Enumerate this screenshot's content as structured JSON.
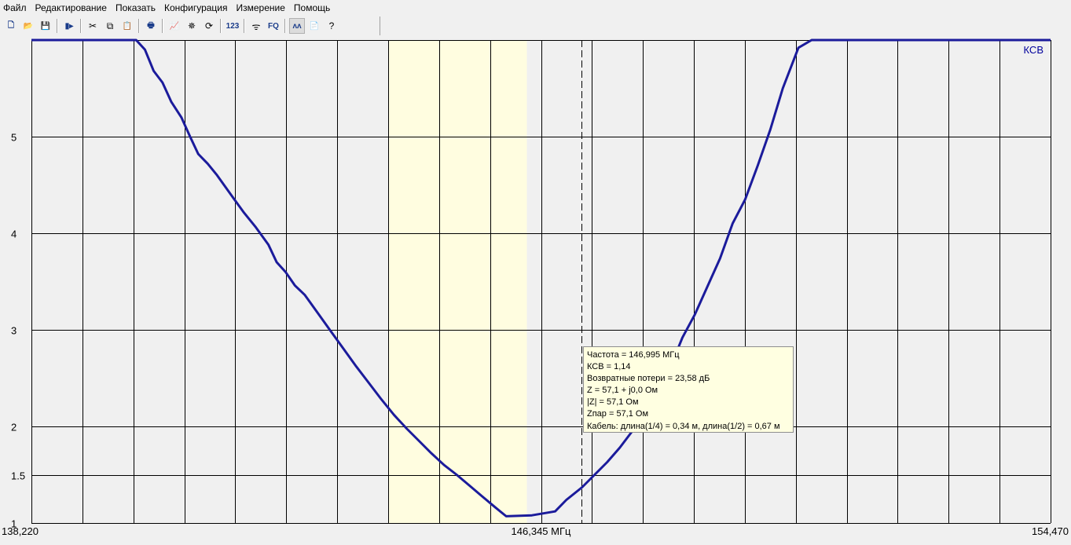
{
  "menu": [
    "Файл",
    "Редактирование",
    "Показать",
    "Конфигурация",
    "Измерение",
    "Помощь"
  ],
  "toolbar": {
    "items": [
      {
        "name": "new-icon",
        "glyph": "🗋"
      },
      {
        "name": "open-icon",
        "glyph": "📂"
      },
      {
        "name": "save-icon",
        "glyph": "💾"
      },
      {
        "sep": true
      },
      {
        "name": "export-icon",
        "glyph": "▮▸"
      },
      {
        "sep": true
      },
      {
        "name": "cut-icon",
        "glyph": "✂"
      },
      {
        "name": "copy-icon",
        "glyph": "⧉"
      },
      {
        "name": "paste-icon",
        "glyph": "📋"
      },
      {
        "sep": true
      },
      {
        "name": "print-icon",
        "glyph": "🖶"
      },
      {
        "sep": true
      },
      {
        "name": "graph-icon",
        "glyph": "📈"
      },
      {
        "name": "marker-icon",
        "glyph": "✵"
      },
      {
        "name": "refresh-icon",
        "glyph": "⟳"
      },
      {
        "sep": true
      },
      {
        "name": "numeric-icon",
        "glyph": "123"
      },
      {
        "sep": true
      },
      {
        "name": "antenna-icon",
        "glyph": "ᯤ"
      },
      {
        "name": "fq-icon",
        "glyph": "FQ"
      },
      {
        "sep": true
      },
      {
        "name": "curves-icon",
        "glyph": "ʌʌ",
        "pressed": true
      },
      {
        "name": "notes-icon",
        "glyph": "📄"
      },
      {
        "name": "help-icon",
        "glyph": "?"
      }
    ]
  },
  "colors": {
    "curve": "#1b1b9b",
    "plot_bg": "#f0f0f0",
    "band": "#fffde0",
    "grid": "#000000",
    "label": "#00009c"
  },
  "chart_data": {
    "type": "line",
    "title": "",
    "series": [
      {
        "name": "КСВ",
        "label": "КСВ"
      }
    ],
    "xlim": [
      138.22,
      154.47
    ],
    "ylim": [
      1,
      6
    ],
    "x_left_label": "138,220",
    "x_center_label": "146,345 МГц",
    "x_right_label": "154,470",
    "y_ticks": [
      {
        "value": 1,
        "label": "1"
      },
      {
        "value": 1.5,
        "label": "1.5"
      },
      {
        "value": 2,
        "label": "2"
      },
      {
        "value": 3,
        "label": "3"
      },
      {
        "value": 4,
        "label": "4"
      },
      {
        "value": 5,
        "label": "5"
      }
    ],
    "x_grid_divisions": 20,
    "highlight_band": [
      143.92,
      146.12
    ],
    "marker_x": 146.995,
    "points": [
      [
        138.22,
        6.0
      ],
      [
        139.89,
        6.0
      ],
      [
        140.03,
        5.9
      ],
      [
        140.17,
        5.68
      ],
      [
        140.31,
        5.56
      ],
      [
        140.45,
        5.36
      ],
      [
        140.61,
        5.2
      ],
      [
        140.75,
        5.0
      ],
      [
        140.88,
        4.82
      ],
      [
        141.03,
        4.72
      ],
      [
        141.18,
        4.6
      ],
      [
        141.4,
        4.4
      ],
      [
        141.6,
        4.22
      ],
      [
        141.8,
        4.06
      ],
      [
        142.0,
        3.88
      ],
      [
        142.13,
        3.7
      ],
      [
        142.27,
        3.6
      ],
      [
        142.42,
        3.46
      ],
      [
        142.58,
        3.36
      ],
      [
        142.8,
        3.16
      ],
      [
        143.0,
        2.98
      ],
      [
        143.2,
        2.8
      ],
      [
        143.4,
        2.62
      ],
      [
        143.6,
        2.45
      ],
      [
        143.8,
        2.28
      ],
      [
        144.0,
        2.12
      ],
      [
        144.2,
        1.98
      ],
      [
        144.4,
        1.85
      ],
      [
        144.6,
        1.72
      ],
      [
        144.8,
        1.6
      ],
      [
        145.0,
        1.5
      ],
      [
        145.2,
        1.39
      ],
      [
        145.4,
        1.28
      ],
      [
        145.62,
        1.16
      ],
      [
        145.79,
        1.07
      ],
      [
        146.2,
        1.08
      ],
      [
        146.57,
        1.12
      ],
      [
        146.75,
        1.24
      ],
      [
        147.0,
        1.37
      ],
      [
        147.2,
        1.5
      ],
      [
        147.4,
        1.63
      ],
      [
        147.6,
        1.78
      ],
      [
        147.8,
        1.95
      ],
      [
        148.0,
        2.12
      ],
      [
        148.2,
        2.34
      ],
      [
        148.4,
        2.6
      ],
      [
        148.6,
        2.92
      ],
      [
        148.8,
        3.16
      ],
      [
        149.0,
        3.45
      ],
      [
        149.2,
        3.74
      ],
      [
        149.4,
        4.1
      ],
      [
        149.6,
        4.35
      ],
      [
        149.8,
        4.7
      ],
      [
        150.0,
        5.07
      ],
      [
        150.2,
        5.5
      ],
      [
        150.45,
        5.92
      ],
      [
        150.66,
        6.0
      ],
      [
        154.47,
        6.0
      ]
    ]
  },
  "tooltip": {
    "lines": [
      "Частота = 146,995 МГц",
      "КСВ = 1,14",
      "Возвратные потери = 23,58 дБ",
      "Z = 57,1 + j0,0 Ом",
      "|Z| = 57,1 Ом",
      "Zпар = 57,1 Ом",
      "Кабель: длина(1/4) = 0,34 м, длина(1/2) = 0,67 м"
    ]
  }
}
